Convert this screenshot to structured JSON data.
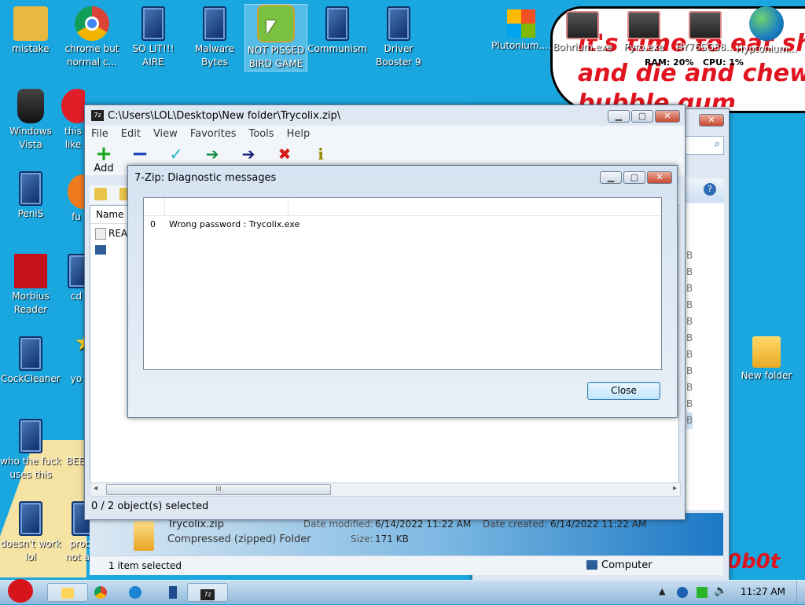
{
  "desktop": {
    "wallpaper_text": [
      "it's time to eat shit",
      "and die and chew",
      "bubble gum"
    ],
    "corner_text": "0b0t",
    "monitor_readout": "RAM: 20%   CPU: 1%",
    "icons": [
      {
        "label": "mistake"
      },
      {
        "label": "chrome but normal c..."
      },
      {
        "label": "SO LIT!!! AIRE"
      },
      {
        "label": "Malware Bytes"
      },
      {
        "label": "NOT PISSED BIRD GAME"
      },
      {
        "label": "Communism"
      },
      {
        "label": "Driver Booster 9"
      },
      {
        "label": "Plutonium...."
      },
      {
        "label": "Bohrium.exe"
      },
      {
        "label": "Pyro.exe"
      },
      {
        "label": "HY76SG38..."
      },
      {
        "label": "Hyptonium..."
      },
      {
        "label": "Windows Vista"
      },
      {
        "label": "this like"
      },
      {
        "label": "PeniS"
      },
      {
        "label": "fu"
      },
      {
        "label": "Morbius Reader"
      },
      {
        "label": "cd"
      },
      {
        "label": "CockCleaner"
      },
      {
        "label": "yo"
      },
      {
        "label": "who the fuck uses this"
      },
      {
        "label": "BEE"
      },
      {
        "label": "doesn't work lol"
      },
      {
        "label": "proba not ano"
      },
      {
        "label": "New folder"
      }
    ]
  },
  "explorer": {
    "details_name": "Trycolix.zip",
    "details_type": "Compressed (zipped) Folder",
    "date_modified_label": "Date modified:",
    "date_modified": "6/14/2022 11:22 AM",
    "date_created_label": "Date created:",
    "date_created": "6/14/2022 11:22 AM",
    "size_label": "Size:",
    "size": "171 KB",
    "status": "1 item selected",
    "status_location": "Computer",
    "size_unit_letter": "B",
    "help_icon": "?"
  },
  "sevenzip": {
    "title": "C:\\Users\\LOL\\Desktop\\New folder\\Trycolix.zip\\",
    "menu": [
      "File",
      "Edit",
      "View",
      "Favorites",
      "Tools",
      "Help"
    ],
    "toolbar_add": "Add",
    "column_name": "Name",
    "file_row": "REA",
    "status": "0 / 2 object(s) selected",
    "scroll_grip": "III"
  },
  "diagnostic": {
    "title": "7-Zip: Diagnostic messages",
    "rows": [
      {
        "index": "0",
        "message": "Wrong password : Trycolix.exe"
      }
    ],
    "close_label": "Close"
  },
  "taskbar": {
    "clock": "11:27 AM"
  },
  "colors": {
    "desktop_bg": "#1aa7e0",
    "wallpaper_text": "#e0141e",
    "window_frame": "#dfe8f2",
    "taskbar": "#a9c9e6"
  }
}
